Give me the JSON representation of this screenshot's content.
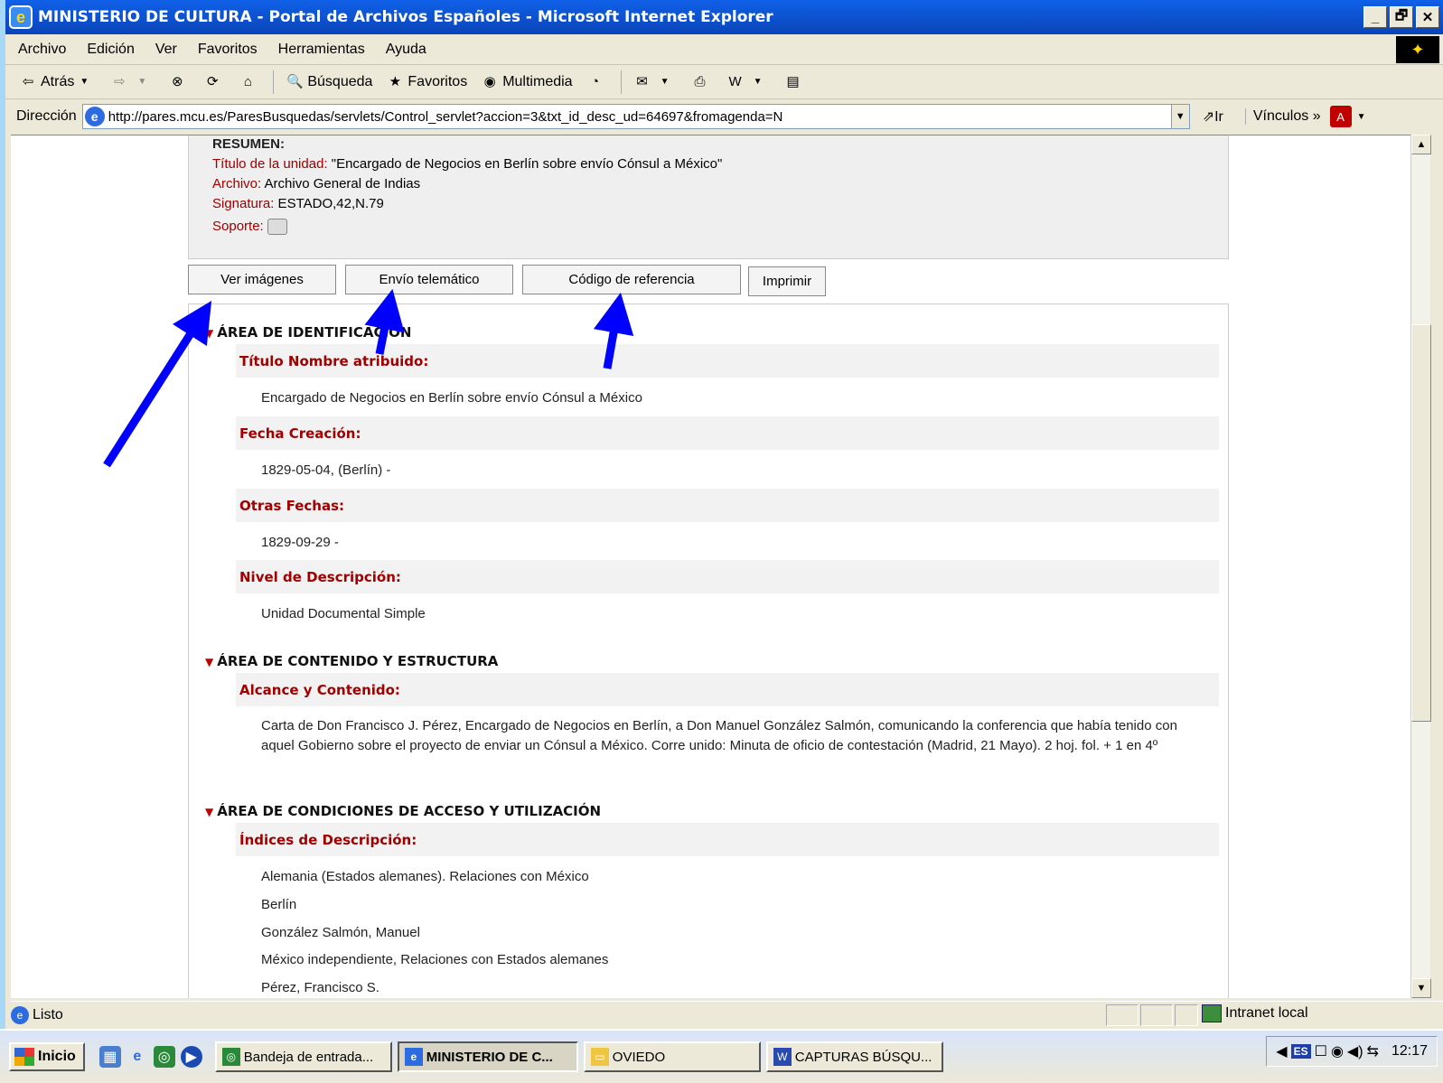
{
  "window": {
    "title": "MINISTERIO DE CULTURA - Portal de Archivos Españoles - Microsoft Internet Explorer",
    "controls": [
      "_",
      "🗗",
      "✕"
    ]
  },
  "menu": [
    "Archivo",
    "Edición",
    "Ver",
    "Favoritos",
    "Herramientas",
    "Ayuda"
  ],
  "toolbar": {
    "back": "Atrás",
    "search": "Búsqueda",
    "favorites": "Favoritos",
    "media": "Multimedia"
  },
  "address": {
    "label": "Dirección",
    "url": "http://pares.mcu.es/ParesBusquedas/servlets/Control_servlet?accion=3&txt_id_desc_ud=64697&fromagenda=N",
    "go": "Ir",
    "links": "Vínculos"
  },
  "resumen": {
    "heading": "RESUMEN:",
    "rows": [
      {
        "label": "Título de la unidad:",
        "value": " \"Encargado de Negocios en Berlín sobre envío Cónsul a México\""
      },
      {
        "label": "Archivo:",
        "value": " Archivo General de Indias"
      },
      {
        "label": "Signatura:",
        "value": " ESTADO,42,N.79"
      }
    ],
    "soporte_label": "Soporte:"
  },
  "buttons": {
    "ver_imagenes": "Ver imágenes",
    "envio": "Envío telemático",
    "codigo": "Código de referencia",
    "imprimir": "Imprimir"
  },
  "areas": {
    "identificacion": "ÁREA DE IDENTIFICACIÓN",
    "contenido": "ÁREA DE CONTENIDO Y ESTRUCTURA",
    "acceso": "ÁREA DE CONDICIONES DE ACCESO Y UTILIZACIÓN"
  },
  "fields": {
    "titulo_h": "Título Nombre atribuido:",
    "titulo_v": "Encargado de Negocios en Berlín sobre envío Cónsul a México",
    "fecha_h": "Fecha Creación:",
    "fecha_v": "1829-05-04, (Berlín)  -",
    "otras_h": "Otras Fechas:",
    "otras_v": "1829-09-29 -",
    "nivel_h": "Nivel de Descripción:",
    "nivel_v": "Unidad Documental Simple",
    "alcance_h": "Alcance y Contenido:",
    "alcance_v": "Carta de Don Francisco J. Pérez, Encargado de Negocios en Berlín, a Don Manuel González Salmón, comunicando la conferencia que había tenido con aquel Gobierno sobre el proyecto de enviar un Cónsul a México. Corre unido: Minuta de oficio de contestación (Madrid, 21 Mayo). 2 hoj. fol. + 1 en 4º",
    "indices_h": "Índices de Descripción:",
    "indices": [
      "Alemania (Estados alemanes). Relaciones con México",
      "Berlín",
      "González Salmón, Manuel",
      "México independiente, Relaciones con Estados alemanes",
      "Pérez, Francisco S."
    ]
  },
  "status": {
    "text": "Listo",
    "zone": "Intranet local"
  },
  "taskbar": {
    "start": "Inicio",
    "tasks": [
      "Bandeja de entrada...",
      "MINISTERIO DE C...",
      "OVIEDO",
      "CAPTURAS BÚSQU..."
    ],
    "lang": "ES",
    "clock": "12:17"
  },
  "colors": {
    "title_blue": "#0a44b8",
    "label_red": "#a00000",
    "arrow_blue": "#0000ff"
  }
}
